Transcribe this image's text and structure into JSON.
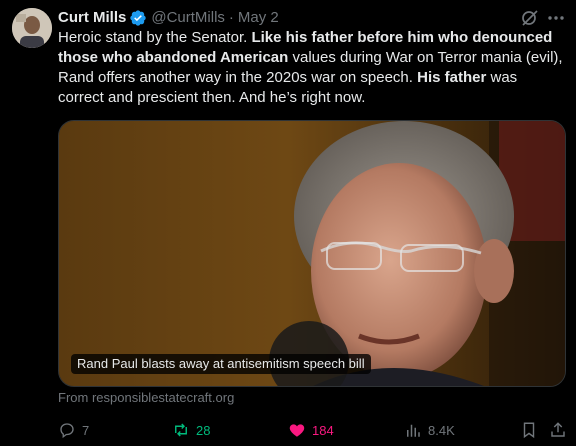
{
  "author": {
    "name": "Curt Mills",
    "handle": "@CurtMills",
    "separator": "·",
    "date": "May 2",
    "verified": true
  },
  "tweet": {
    "segments": [
      {
        "text": "Heroic stand by the Senator. ",
        "bold": false
      },
      {
        "text": "Like his father before him who denounced those who abandoned American",
        "bold": true
      },
      {
        "text": " values during War on Terror mania (evil), Rand offers another way in the 2020s war on speech. ",
        "bold": false
      },
      {
        "text": "His father",
        "bold": true
      },
      {
        "text": " was correct and prescient then. And he’s right now.",
        "bold": false
      }
    ]
  },
  "media": {
    "caption": "Rand Paul blasts away at antisemitism speech bill"
  },
  "link_source": "From responsiblestatecraft.org",
  "actions": {
    "reply_count": "7",
    "repost_count": "28",
    "like_count": "184",
    "views_count": "8.4K"
  },
  "colors": {
    "background": "#000000",
    "text": "#e7e9ea",
    "muted": "#71767b",
    "verified": "#1d9bf0",
    "repost_active": "#00ba7c",
    "like_active": "#f91880"
  },
  "icons": [
    "grok-icon",
    "more-icon",
    "verified-badge-icon",
    "reply-icon",
    "repost-icon",
    "like-icon",
    "views-icon",
    "bookmark-icon",
    "share-icon"
  ]
}
